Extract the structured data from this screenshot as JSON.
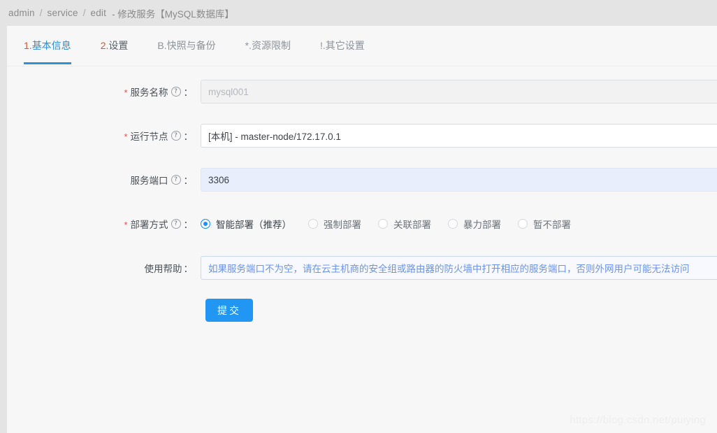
{
  "breadcrumb": {
    "items": [
      "admin",
      "service",
      "edit"
    ],
    "separator": "/",
    "current": "-  修改服务【MySQL数据库】"
  },
  "tabs": [
    {
      "prefix": "1.",
      "label": "基本信息",
      "active": true
    },
    {
      "prefix": "2.",
      "label": "设置",
      "active": false
    },
    {
      "prefix": "B.",
      "label": "快照与备份",
      "active": false
    },
    {
      "prefix": "*.",
      "label": "资源限制",
      "active": false
    },
    {
      "prefix": "!.",
      "label": "其它设置",
      "active": false
    }
  ],
  "form": {
    "help_icon": "?",
    "colon": "：",
    "required_mark": "*",
    "rows": [
      {
        "label": "服务名称",
        "required": true,
        "help": true,
        "value": "mysql001",
        "state": "disabled"
      },
      {
        "label": "运行节点",
        "required": true,
        "help": true,
        "value": "[本机] - master-node/172.17.0.1",
        "state": "normal"
      },
      {
        "label": "服务端口",
        "required": false,
        "help": true,
        "value": "3306",
        "state": "highlight"
      }
    ],
    "deploy": {
      "label": "部署方式",
      "required": true,
      "help": true,
      "options": [
        {
          "label": "智能部署（推荐）",
          "checked": true
        },
        {
          "label": "强制部署",
          "checked": false
        },
        {
          "label": "关联部署",
          "checked": false
        },
        {
          "label": "暴力部署",
          "checked": false
        },
        {
          "label": "暂不部署",
          "checked": false
        }
      ]
    },
    "usage_help": {
      "label": "使用帮助",
      "required": false,
      "help": false,
      "text": "如果服务端口不为空，请在云主机商的安全组或路由器的防火墙中打开相应的服务端口，否则外网用户可能无法访问"
    },
    "submit_label": "提交"
  },
  "watermark": "https://blog.csdn.net/puiying",
  "colors": {
    "accent_blue": "#2196f3",
    "tab_active_text": "#2b8fd6",
    "tab_prefix_orange": "#e8541e",
    "required_red": "#e84b4b",
    "help_text_blue": "#6b94e8",
    "page_background": "#e4e4e4",
    "card_background": "#f7f7f8"
  }
}
